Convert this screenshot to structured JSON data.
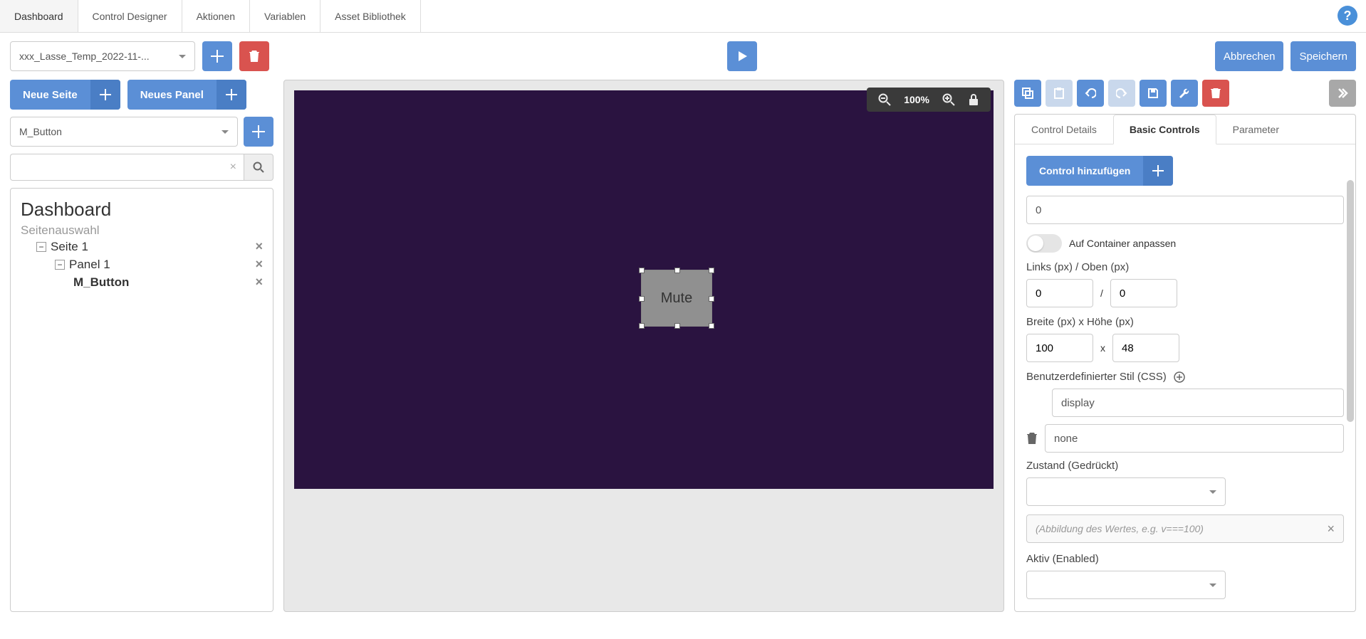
{
  "topnav": {
    "tabs": [
      "Dashboard",
      "Control Designer",
      "Aktionen",
      "Variablen",
      "Asset Bibliothek"
    ],
    "active": 0
  },
  "row2": {
    "dashboard_select": "xxx_Lasse_Temp_2022-11-...",
    "cancel": "Abbrechen",
    "save": "Speichern"
  },
  "left": {
    "new_page": "Neue Seite",
    "new_panel": "Neues Panel",
    "control_select": "M_Button",
    "tree": {
      "title": "Dashboard",
      "subtitle": "Seitenauswahl",
      "page": "Seite 1",
      "panel": "Panel 1",
      "control": "M_Button"
    }
  },
  "canvas": {
    "zoom": "100%",
    "button_label": "Mute"
  },
  "right": {
    "tabs": [
      "Control Details",
      "Basic Controls",
      "Parameter"
    ],
    "active": 1,
    "add_control": "Control hinzufügen",
    "value_input": "0",
    "fit_container": "Auf Container anpassen",
    "left_top_label": "Links (px) / Oben (px)",
    "left_val": "0",
    "top_val": "0",
    "wh_label": "Breite (px) x Höhe (px)",
    "width_val": "100",
    "height_val": "48",
    "css_label": "Benutzerdefinierter Stil (CSS)",
    "css_prop": "display",
    "css_val": "none",
    "state_label": "Zustand (Gedrückt)",
    "mapping_placeholder": "(Abbildung des Wertes, e.g. v===100)",
    "active_label": "Aktiv (Enabled)"
  }
}
